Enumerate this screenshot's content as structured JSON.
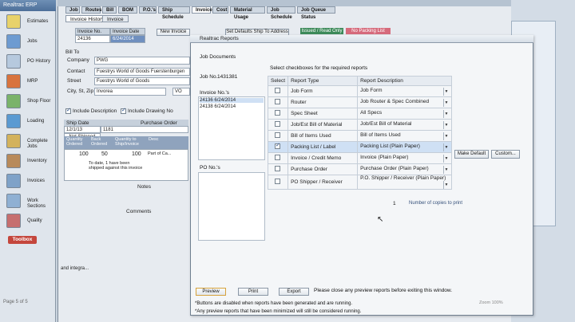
{
  "erp": {
    "title": "Realtrac ERP",
    "nav": [
      "Estimates",
      "Jobs",
      "PO History",
      "MRP",
      "Shop Floor",
      "Loading",
      "Complete Jobs",
      "Inventory",
      "Invoices",
      "Work Sections",
      "Quality"
    ],
    "toolbox": "Toolbox",
    "status": "Page 5 of 5"
  },
  "invoice": {
    "tabs": [
      "Job",
      "Routes",
      "Bill",
      "BOM",
      "P.O.'s",
      "Ship Schedule",
      "Invoice",
      "Cost",
      "Material Usage",
      "Job Schedule",
      "Job Queue Status"
    ],
    "active_tab": "Invoice",
    "subtabs": [
      "Invoice History",
      "Invoice"
    ],
    "col_invoice_no": "Invoice No.",
    "col_invoice_date": "Invoice Date",
    "invoice_no": "24136",
    "invoice_date": "6/24/2014",
    "new_invoice": "New Invoice",
    "set_defaults": "Set Defaults Ship To Address",
    "status_green": "Issued / Read Only",
    "status_red": "No Packing List",
    "bill_to_label": "Bill To",
    "company_label": "Company",
    "company_value": "PWG",
    "contact_label": "Contact",
    "contact_value": "Fuestrys World of Goods Fuerstenburgen",
    "street_label": "Street",
    "street_value": "Fuestrys World of Goods",
    "city_label": "City, St, Zip",
    "city_value": "Invorea",
    "state_value": "VO",
    "include_description": "Include Description",
    "include_drawing": "Include Drawing No",
    "grid_col_ship_date": "Ship Date",
    "grid_col_purchase_order": "Purchase Order",
    "grid_row_ship_date": "12/1/13",
    "grid_row_status": "Not Shipped",
    "grid_row_po": "1181",
    "qty_headers": [
      "Quantity Ordered",
      "Back Ordered",
      "Quantity to Ship/Invoice",
      "Desc"
    ],
    "qty_row": [
      "100",
      "50",
      "100",
      "Part of Ca..."
    ],
    "ship_note": "To date, 1 have been shipped against this invoice",
    "notes_label": "Notes",
    "comments_label": "Comments",
    "bottom_text": "and integra..."
  },
  "dialog": {
    "title": "Realtrac Reports",
    "job_documents": "Job Documents",
    "job_no_label": "Job No.",
    "job_no": "1431381",
    "invoice_nos_label": "Invoice No.'s",
    "invoices": [
      "24136   6/24/2014",
      "24138   6/24/2014"
    ],
    "po_nos_label": "PO No.'s",
    "select_prompt": "Select checkboxes for the required reports",
    "col_select": "Select",
    "col_report_type": "Report Type",
    "col_report_description": "Report Description",
    "rows": [
      {
        "type": "Job Form",
        "desc": "Job Form",
        "checked": false
      },
      {
        "type": "Router",
        "desc": "Job Router & Spec Combined",
        "checked": false
      },
      {
        "type": "Spec Sheet",
        "desc": "All Specs",
        "checked": false
      },
      {
        "type": "Job/Est Bill of Material",
        "desc": "Job/Est Bill of Material",
        "checked": false
      },
      {
        "type": "Bill of Items Used",
        "desc": "Bill of Items Used",
        "checked": false
      },
      {
        "type": "Packing List / Label",
        "desc": "Packing List (Plain Paper)",
        "checked": true
      },
      {
        "type": "Invoice / Credit Memo",
        "desc": "Invoice (Plain Paper)",
        "checked": false
      },
      {
        "type": "Purchase Order",
        "desc": "Purchase Order (Plain Paper)",
        "checked": false
      },
      {
        "type": "PO Shipper / Receiver",
        "desc": "P.O. Shipper / Receiver (Plain Paper)",
        "checked": false
      }
    ],
    "make_default": "Make Default",
    "customize": "Custom...",
    "copies_value": "1",
    "copies_label": "Number of copies to print",
    "preview": "Preview",
    "print": "Print",
    "export": "Export",
    "close_note": "Please close any preview reports before exiting this window.",
    "footer1": "*Buttons are disabled when reports have been generated and are running.",
    "footer2": "*Any preview reports that have been minimized will still be considered running.",
    "zoom": "Zoom 100%"
  }
}
